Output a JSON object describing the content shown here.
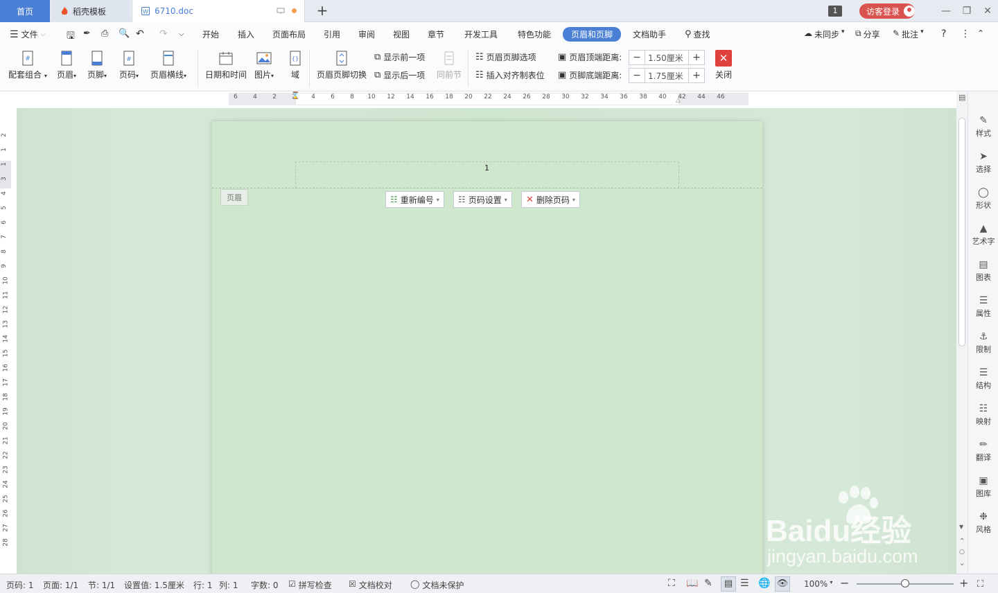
{
  "titlebar": {
    "tabs": [
      {
        "label": "首页"
      },
      {
        "label": "稻壳模板"
      },
      {
        "label": "6710.doc"
      }
    ],
    "account_badge": "1",
    "guest_login": "访客登录"
  },
  "menubar": {
    "file": "文件",
    "items": [
      "开始",
      "插入",
      "页面布局",
      "引用",
      "审阅",
      "视图",
      "章节",
      "开发工具",
      "特色功能",
      "页眉和页脚",
      "文档助手"
    ],
    "active": "页眉和页脚",
    "search": "查找",
    "sync": "未同步",
    "share": "分享",
    "comment": "批注"
  },
  "toolbar": {
    "combo": "配套组合",
    "header": "页眉",
    "footer": "页脚",
    "page_number": "页码",
    "header_line": "页眉横线",
    "date_time": "日期和时间",
    "picture": "图片",
    "field": "域",
    "switch": "页眉页脚切换",
    "show_prev": "显示前一项",
    "show_next": "显示后一项",
    "same_as_prev": "同前节",
    "options": "页眉页脚选项",
    "insert_tab": "插入对齐制表位",
    "header_top_label": "页眉顶端距离:",
    "header_top_value": "1.50厘米",
    "footer_bottom_label": "页脚底端距离:",
    "footer_bottom_value": "1.75厘米",
    "close": "关闭"
  },
  "ruler": {
    "h_ticks": [
      "6",
      "4",
      "2",
      "2",
      "4",
      "6",
      "8",
      "10",
      "12",
      "14",
      "16",
      "18",
      "20",
      "22",
      "24",
      "26",
      "28",
      "30",
      "32",
      "34",
      "36",
      "38",
      "40",
      "42",
      "44",
      "46"
    ],
    "v_ticks": [
      "2",
      "1",
      "1",
      "3",
      "4",
      "5",
      "6",
      "7",
      "8",
      "9",
      "10",
      "11",
      "12",
      "13",
      "14",
      "15",
      "16",
      "17",
      "18",
      "19",
      "20",
      "21",
      "22",
      "23",
      "24",
      "25",
      "26",
      "27",
      "28"
    ]
  },
  "document": {
    "header_content": "1",
    "header_tag": "页眉",
    "renumber": "重新编号",
    "page_num_settings": "页码设置",
    "delete_page_num": "删除页码"
  },
  "rightpanel": [
    "样式",
    "选择",
    "形状",
    "艺术字",
    "图表",
    "属性",
    "限制",
    "结构",
    "映射",
    "翻译",
    "图库",
    "风格"
  ],
  "statusbar": {
    "page_num": "页码: 1",
    "pages": "页面: 1/1",
    "section": "节: 1/1",
    "setting": "设置值: 1.5厘米",
    "row": "行: 1",
    "col": "列: 1",
    "words": "字数: 0",
    "spell": "拼写检查",
    "proof": "文档校对",
    "protect": "文档未保护",
    "zoom": "100%",
    "zoom_level": 0.5
  },
  "watermark": {
    "brand": "Baidu经验",
    "url": "jingyan.baidu.com"
  },
  "colors": {
    "accent": "#4a7fd6",
    "page_bg": "#cfe7cd",
    "close": "#e0403c"
  }
}
